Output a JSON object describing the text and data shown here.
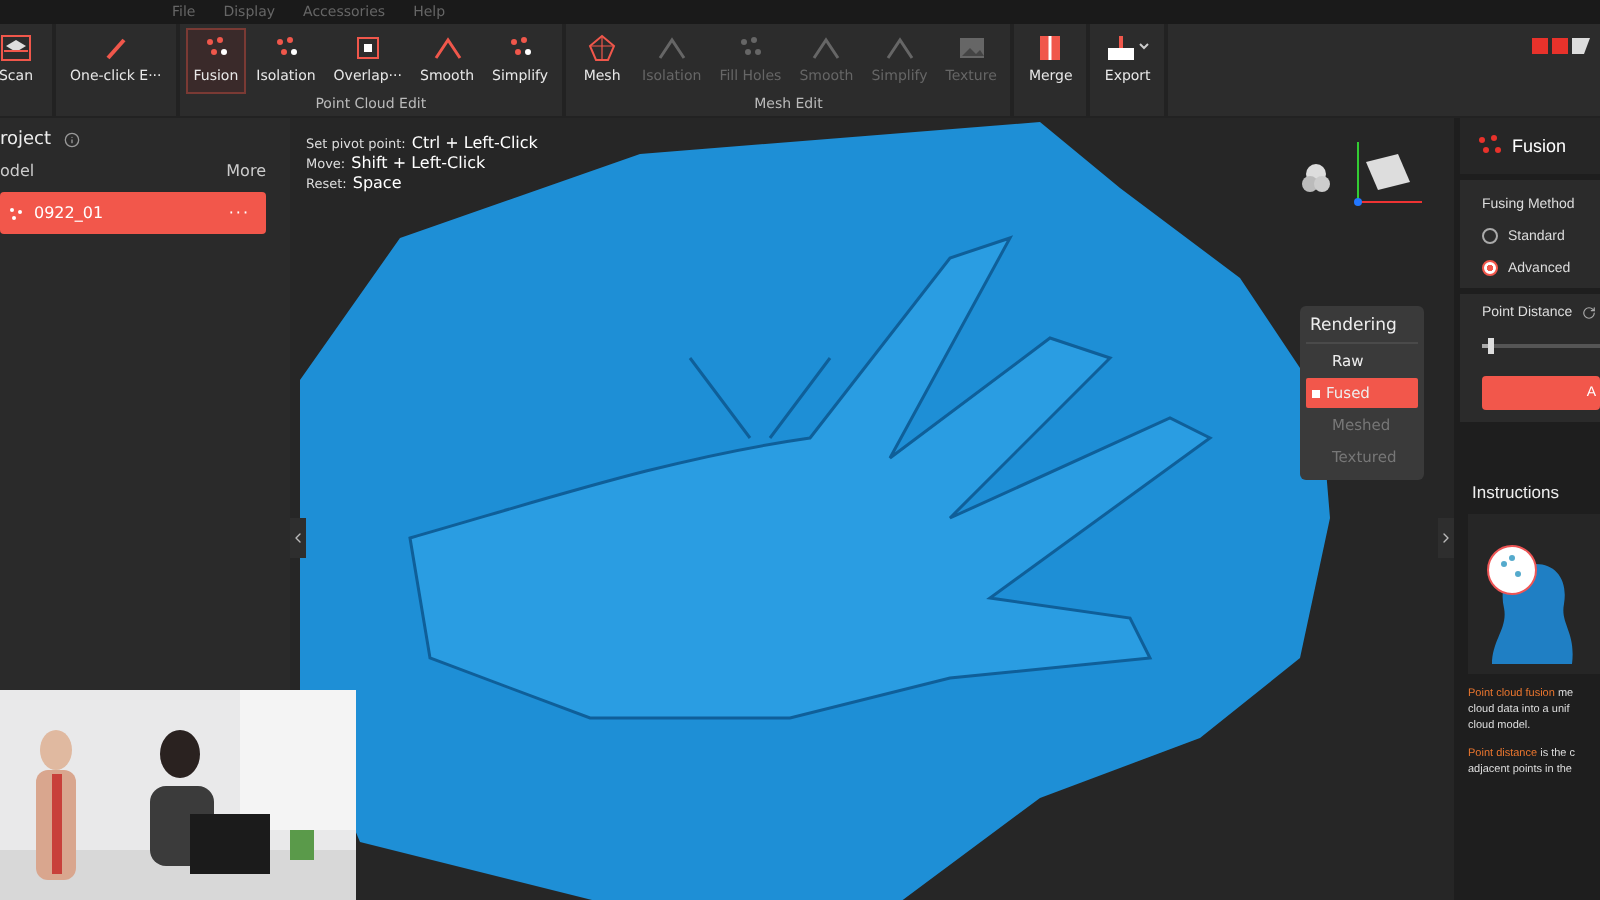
{
  "menu": [
    "File",
    "Display",
    "Accessories",
    "Help"
  ],
  "toolbar": {
    "groups": [
      {
        "buttons": [
          {
            "label": "Scan",
            "selected": false,
            "disabled": false
          }
        ]
      },
      {
        "buttons": [
          {
            "label": "One-click E···",
            "selected": false,
            "disabled": false
          }
        ]
      },
      {
        "label": "Point Cloud Edit",
        "buttons": [
          {
            "label": "Fusion",
            "selected": true,
            "disabled": false
          },
          {
            "label": "Isolation",
            "selected": false,
            "disabled": false
          },
          {
            "label": "Overlap···",
            "selected": false,
            "disabled": false
          },
          {
            "label": "Smooth",
            "selected": false,
            "disabled": false
          },
          {
            "label": "Simplify",
            "selected": false,
            "disabled": false
          }
        ]
      },
      {
        "label": "Mesh Edit",
        "buttons": [
          {
            "label": "Mesh",
            "selected": false,
            "disabled": false
          },
          {
            "label": "Isolation",
            "selected": false,
            "disabled": true
          },
          {
            "label": "Fill Holes",
            "selected": false,
            "disabled": true
          },
          {
            "label": "Smooth",
            "selected": false,
            "disabled": true
          },
          {
            "label": "Simplify",
            "selected": false,
            "disabled": true
          },
          {
            "label": "Texture",
            "selected": false,
            "disabled": true
          }
        ]
      },
      {
        "buttons": [
          {
            "label": "Merge",
            "selected": false,
            "disabled": false
          }
        ]
      },
      {
        "buttons": [
          {
            "label": "Export",
            "selected": false,
            "disabled": false
          }
        ]
      }
    ]
  },
  "project": {
    "title": "roject",
    "column": "odel",
    "more": "More",
    "items": [
      {
        "name": "0922_01",
        "menu": "···",
        "selected": true
      }
    ]
  },
  "viewport": {
    "hints": [
      {
        "label": "Set pivot point:",
        "keys": "Ctrl + Left-Click"
      },
      {
        "label": "Move:",
        "keys": "Shift + Left-Click"
      },
      {
        "label": "Reset:",
        "keys": "Space"
      }
    ],
    "rendering": {
      "title": "Rendering",
      "items": [
        {
          "label": "Raw",
          "selected": false,
          "disabled": false
        },
        {
          "label": "Fused",
          "selected": true,
          "disabled": false
        },
        {
          "label": "Meshed",
          "selected": false,
          "disabled": true
        },
        {
          "label": "Textured",
          "selected": false,
          "disabled": true
        }
      ]
    }
  },
  "fusion": {
    "title": "Fusion",
    "method_title": "Fusing Method",
    "methods": [
      {
        "label": "Standard",
        "selected": false
      },
      {
        "label": "Advanced",
        "selected": true
      }
    ],
    "distance_title": "Point Distance",
    "level": 0.04,
    "apply": "A",
    "instructions_title": "Instructions",
    "paragraphs": [
      [
        {
          "highlight": "Point cloud fusion",
          "text": "me"
        },
        {
          "text": "cloud data into a unif"
        },
        {
          "text": "cloud model."
        }
      ],
      [
        {
          "highlight": "Point distance",
          "text": "is the c"
        },
        {
          "text": "adjacent points in the"
        }
      ]
    ]
  }
}
